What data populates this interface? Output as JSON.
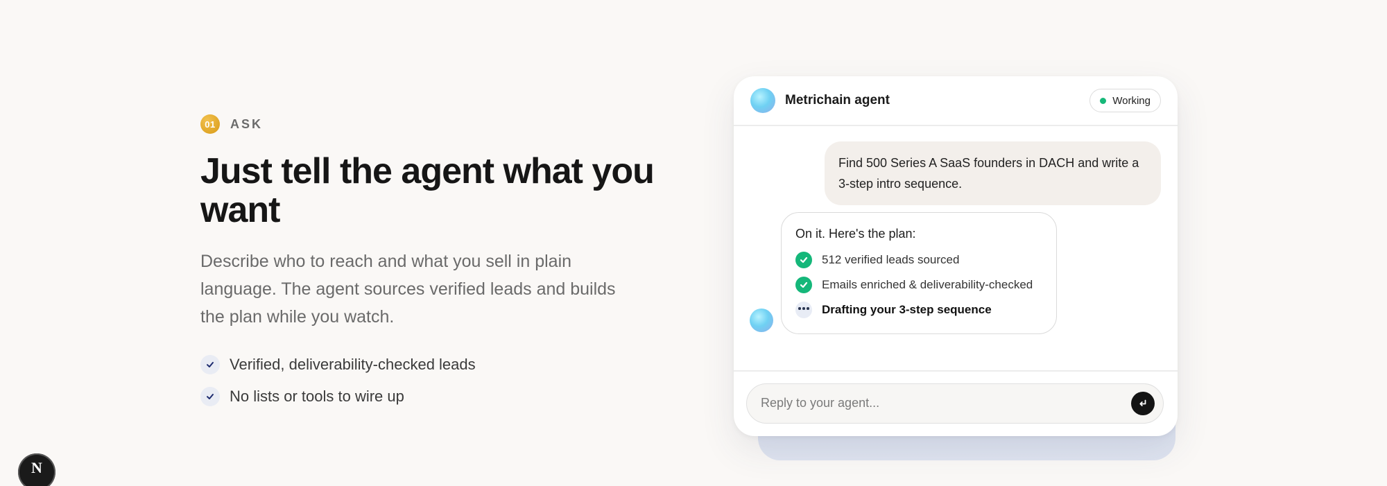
{
  "step": {
    "number": "01",
    "label": "ASK"
  },
  "headline": "Just tell the agent what you want",
  "description": "Describe who to reach and what you sell in plain language. The agent sources verified leads and builds the plan while you watch.",
  "features": [
    {
      "label": "Verified, deliverability-checked leads",
      "icon": "check-icon"
    },
    {
      "label": "No lists or tools to wire up",
      "icon": "check-icon"
    }
  ],
  "chat": {
    "agent_name": "Metrichain agent",
    "status": "Working",
    "status_color": "#16b879",
    "user_message": "Find 500 Series A SaaS founders in DACH and write a 3-step intro sequence.",
    "agent_intro": "On it. Here's the plan:",
    "plan": [
      {
        "label": "512 verified leads sourced",
        "state": "done",
        "icon": "check-icon"
      },
      {
        "label": "Emails enriched & deliverability-checked",
        "state": "done",
        "icon": "check-icon"
      },
      {
        "label": "Drafting your 3-step sequence",
        "state": "in-progress",
        "icon": "ellipsis-icon"
      }
    ],
    "reply_placeholder": "Reply to your agent...",
    "send_icon": "enter-icon"
  },
  "badge": {
    "letter": "N"
  },
  "colors": {
    "background": "#faf8f6",
    "accent_gold": "#d89a16",
    "success_green": "#15b77a",
    "text_primary": "#161616"
  }
}
